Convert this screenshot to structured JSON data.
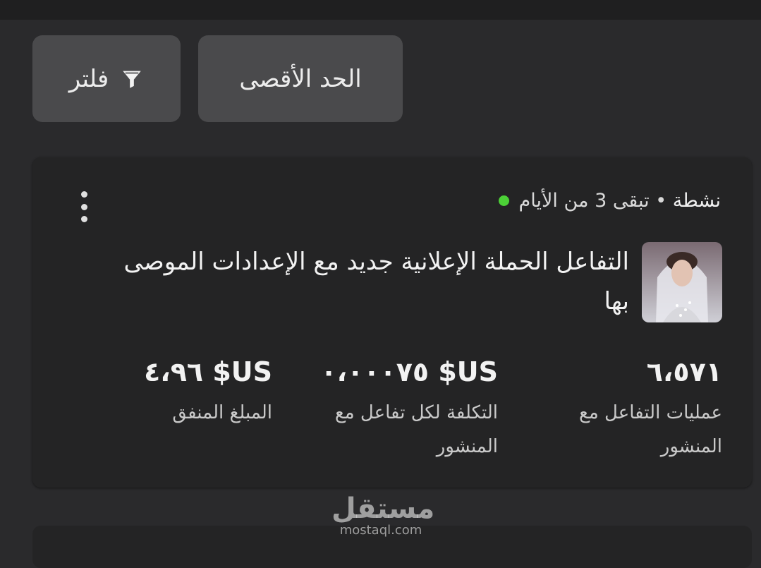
{
  "toolbar": {
    "filter_label": "فلتر",
    "max_label": "الحد الأقصى"
  },
  "campaign": {
    "status": "نشطة",
    "remaining": "• تبقى 3 من الأيام",
    "status_color": "#4cd137",
    "title": "التفاعل الحملة الإعلانية جديد مع الإعدادات الموصى بها"
  },
  "metrics": [
    {
      "value": "٦،٥٧١",
      "label": "عمليات  التفاعل مع المنشور"
    },
    {
      "value": "US$ ٠،٠٠٠٧٥",
      "label": "التكلفة لكل تفاعل مع المنشور"
    },
    {
      "value": "US$ ٤،٩٦",
      "label": "المبلغ المنفق"
    }
  ],
  "watermark": {
    "arabic": "مستقل",
    "latin": "mostaql.com"
  },
  "icons": {
    "filter": "filter-icon",
    "menu": "more-vertical-icon",
    "thumbnail": "campaign-thumbnail"
  }
}
